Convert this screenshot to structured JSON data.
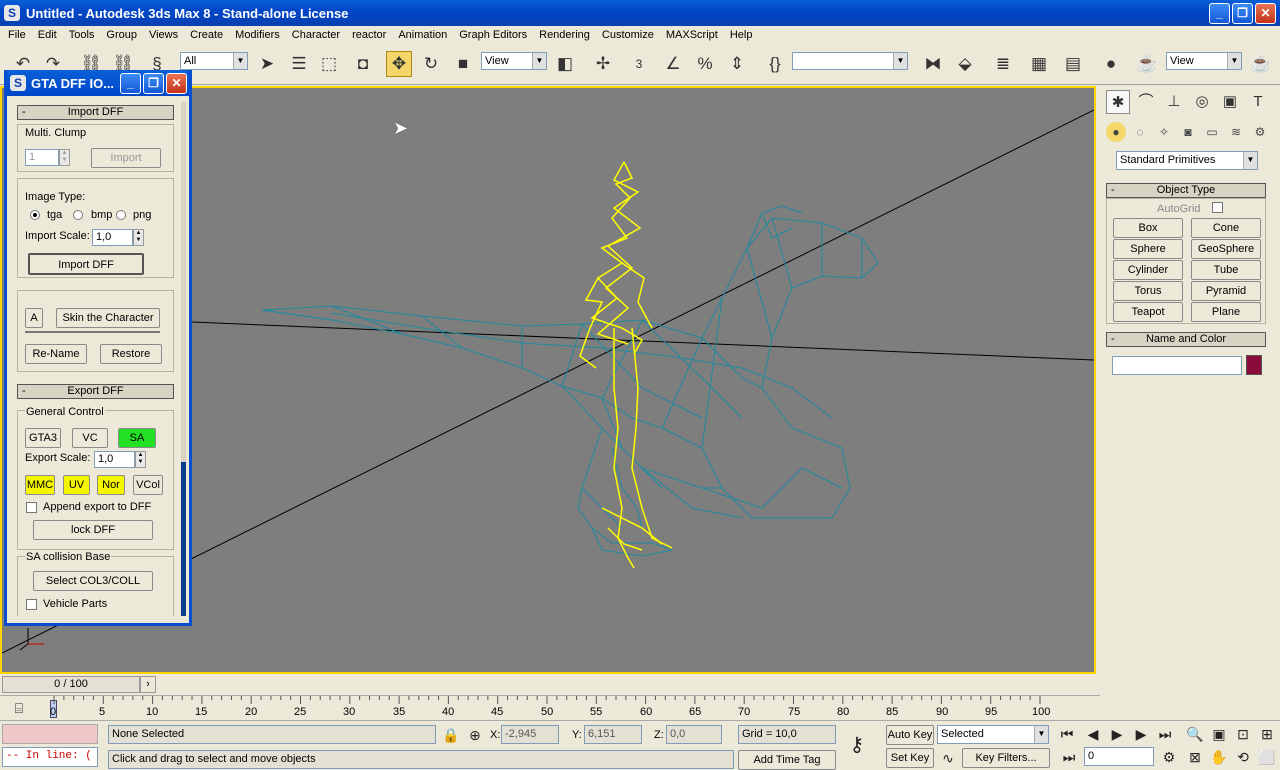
{
  "window": {
    "title": "Untitled - Autodesk 3ds Max 8   - Stand-alone License",
    "app_icon": "S"
  },
  "menu": [
    "File",
    "Edit",
    "Tools",
    "Group",
    "Views",
    "Create",
    "Modifiers",
    "Character",
    "reactor",
    "Animation",
    "Graph Editors",
    "Rendering",
    "Customize",
    "MAXScript",
    "Help"
  ],
  "toolbar": {
    "selection_filter": "All",
    "ref_coord_left": "View",
    "ref_coord_right": "View",
    "snap_3": "3",
    "named_selection": ""
  },
  "dff": {
    "title": "GTA DFF IO...",
    "import_header": "Import DFF",
    "multi_clump_label": "Multi. Clump",
    "multi_clump_value": "1",
    "import_button": "Import",
    "image_type_label": "Image Type:",
    "opt_tga": "tga",
    "opt_bmp": "bmp",
    "opt_png": "png",
    "import_scale_label": "Import Scale:",
    "import_scale_value": "1,0",
    "import_dff_button": "Import DFF",
    "a_button": "A",
    "skin_button": "Skin the Character",
    "rename_button": "Re-Name",
    "restore_button": "Restore",
    "export_header": "Export DFF",
    "general_control_label": "General Control",
    "gta3_button": "GTA3",
    "vc_button": "VC",
    "sa_button": "SA",
    "export_scale_label": "Export Scale:",
    "export_scale_value": "1,0",
    "mmc_button": "MMC",
    "uv_button": "UV",
    "nor_button": "Nor",
    "vcol_button": "VCol",
    "append_label": "Append export to DFF",
    "lock_button": "lock DFF",
    "sa_collision_label": "SA collision Base",
    "select_col_button": "Select COL3/COLL",
    "vehicle_parts_label": "Vehicle Parts"
  },
  "cmd": {
    "category": "Standard Primitives",
    "object_type_header": "Object Type",
    "autogrid_label": "AutoGrid",
    "buttons": [
      "Box",
      "Cone",
      "Sphere",
      "GeoSphere",
      "Cylinder",
      "Tube",
      "Torus",
      "Pyramid",
      "Teapot",
      "Plane"
    ],
    "name_color_header": "Name and Color",
    "name_value": "",
    "color_swatch": "#8a0a3a"
  },
  "time": {
    "slider_label": "0 / 100",
    "ticks": [
      "0",
      "5",
      "10",
      "15",
      "20",
      "25",
      "30",
      "35",
      "40",
      "45",
      "50",
      "55",
      "60",
      "65",
      "70",
      "75",
      "80",
      "85",
      "90",
      "95",
      "100"
    ]
  },
  "status": {
    "script_line": "-- In line: (",
    "selection": "None Selected",
    "prompt": "Click and drag to select and move objects",
    "x_label": "X:",
    "x_value": "-2,945",
    "y_label": "Y:",
    "y_value": "6,151",
    "z_label": "Z:",
    "z_value": "0,0",
    "grid": "Grid = 10,0",
    "add_time_tag": "Add Time Tag",
    "auto_key": "Auto Key",
    "set_key": "Set Key",
    "key_mode": "Selected",
    "key_filters": "Key Filters...",
    "frame_value": "0"
  },
  "colors": {
    "viewport_bg": "#7e7e7e",
    "mesh": "#1f8aa0",
    "bones": "#ffff00",
    "active_border": "#ffd400"
  }
}
